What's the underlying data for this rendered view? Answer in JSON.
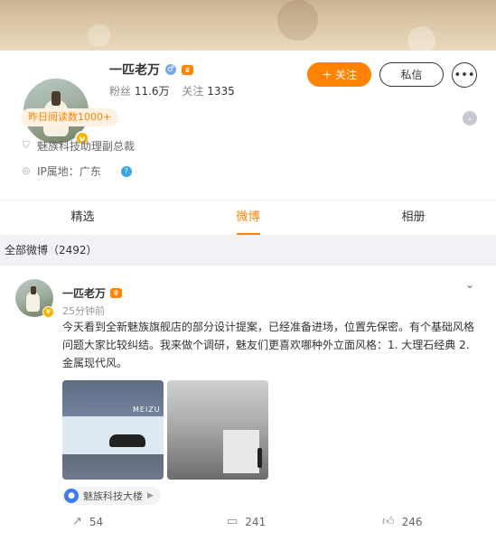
{
  "profile": {
    "name": "一匹老万",
    "fans_label": "粉丝",
    "fans_value": "11.6万",
    "following_label": "关注",
    "following_value": "1335",
    "follow_button": "关注",
    "message_button": "私信",
    "read_badge": "昨日阅读数1000+",
    "title": "魅族科技助理副总裁",
    "ip_location": "IP属地：广东"
  },
  "tabs": [
    {
      "label": "精选",
      "active": false
    },
    {
      "label": "微博",
      "active": true
    },
    {
      "label": "相册",
      "active": false
    }
  ],
  "feed": {
    "section_title": "全部微博（2492）"
  },
  "post": {
    "author": "一匹老万",
    "time": "25分钟前",
    "text": "今天看到全新魅族旗舰店的部分设计提案，已经准备进场，位置先保密。有个基础风格问题大家比较纠结。我来做个调研，魅友们更喜欢哪种外立面风格：1. 大理石经典 2. 金属现代风。",
    "image1_sign": "MEIZU",
    "location": "魅族科技大楼",
    "reposts": "54",
    "comments": "241",
    "likes": "246"
  },
  "colors": {
    "accent": "#ff8200",
    "verified": "#f7b500",
    "location_pin": "#3c7cf0"
  }
}
